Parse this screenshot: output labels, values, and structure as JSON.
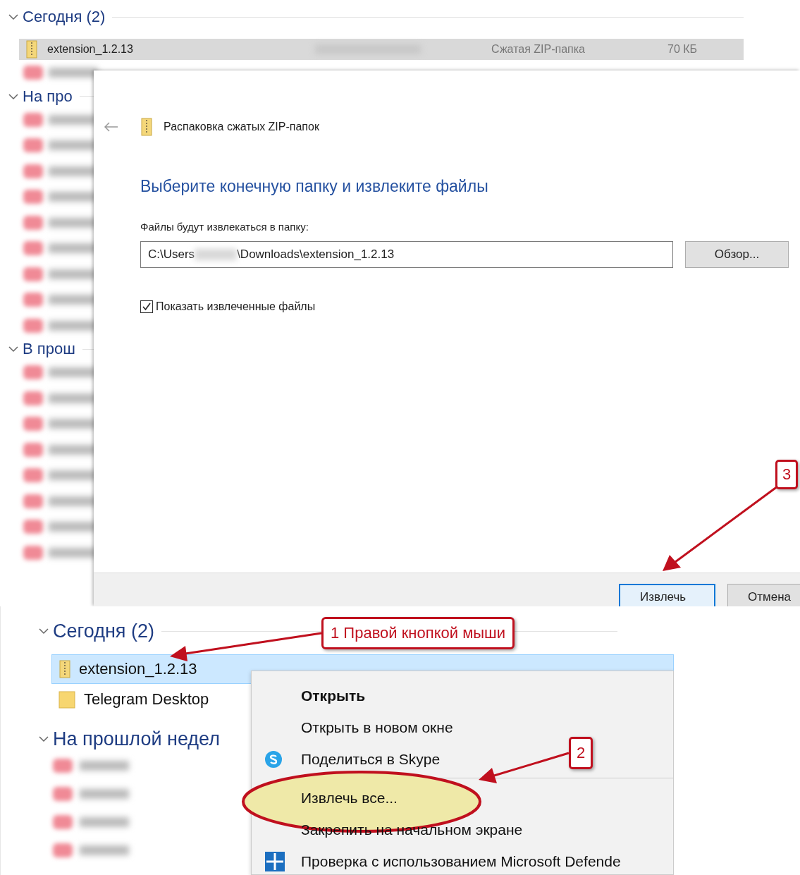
{
  "top": {
    "groups": [
      {
        "label": "Сегодня (2)",
        "expanded": true,
        "rows": [
          {
            "kind": "archive",
            "name": "extension_1.2.13",
            "type": "Сжатая ZIP-папка",
            "size": "70 КБ",
            "selected": true
          }
        ]
      },
      {
        "label": "На про",
        "expanded": true
      },
      {
        "label": "В прош",
        "expanded": true
      }
    ],
    "dialog": {
      "title": "Распаковка сжатых ZIP-папок",
      "heading": "Выберите конечную папку и извлеките файлы",
      "path_label": "Файлы будут извлекаться в папку:",
      "path_start": "C:\\Users",
      "path_end": "\\Downloads\\extension_1.2.13",
      "browse_button": "Обзор...",
      "show_files": {
        "label": "Показать извлеченные файлы",
        "checked": true
      },
      "buttons": [
        {
          "label": "Извлечь",
          "default": true
        },
        {
          "label": "Отмена",
          "default": false
        }
      ]
    },
    "badge": "3"
  },
  "bottom": {
    "groups": [
      {
        "label": "Сегодня (2)",
        "expanded": true,
        "rows": [
          {
            "kind": "archive",
            "name": "extension_1.2.13",
            "selected": true
          },
          {
            "kind": "folder",
            "name": "Telegram Desktop",
            "selected": false
          }
        ]
      },
      {
        "label": "На прошлой недел",
        "expanded": true
      }
    ],
    "context_menu": [
      {
        "kind": "plain",
        "label": "Открыть",
        "bold": true,
        "circled": false
      },
      {
        "kind": "plain",
        "label": "Открыть в новом окне",
        "bold": false,
        "circled": false
      },
      {
        "kind": "share",
        "label": "Поделиться в Skype",
        "bold": false,
        "circled": false
      },
      {
        "kind": "separator"
      },
      {
        "kind": "plain",
        "label": "Извлечь все...",
        "bold": false,
        "circled": true
      },
      {
        "kind": "plain",
        "label": "Закрепить на начальном экране",
        "bold": false,
        "circled": false
      },
      {
        "kind": "scan",
        "label": "Проверка с использованием Microsoft Defende",
        "bold": false,
        "circled": false
      }
    ],
    "callout": "1 Правой кнопкой мыши",
    "badge": "2"
  }
}
